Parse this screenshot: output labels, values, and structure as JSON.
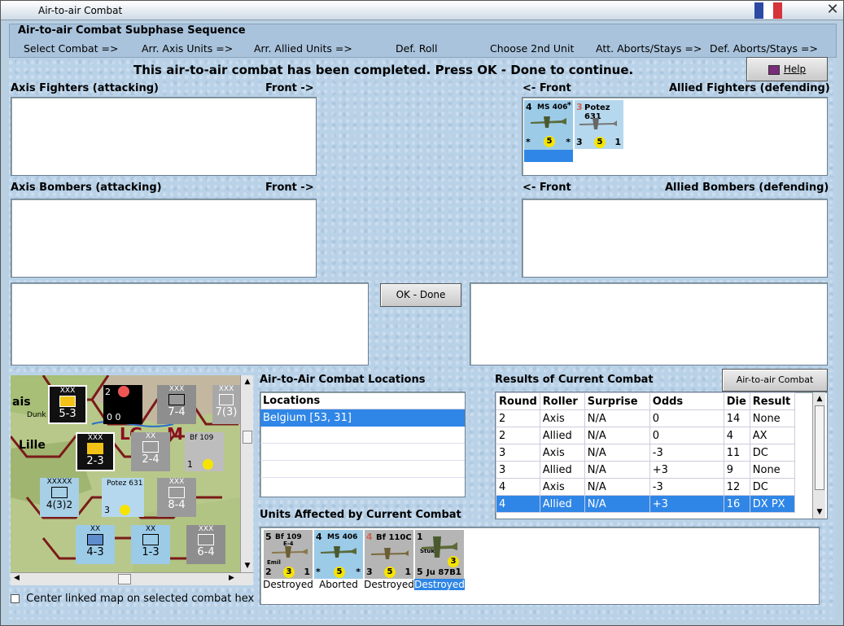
{
  "window": {
    "title": "Air-to-air Combat"
  },
  "sequence": {
    "title": "Air-to-air Combat Subphase Sequence",
    "steps": [
      "Select Combat =>",
      "Arr. Axis Units =>",
      "Arr. Allied Units =>",
      "Def. Roll",
      "Choose 2nd Unit",
      "Att. Aborts/Stays =>",
      "Def. Aborts/Stays =>"
    ]
  },
  "message": "This air-to-air combat has been completed.  Press OK - Done to continue.",
  "help_button": "Help",
  "ok_button": "OK - Done",
  "sections": {
    "axis_fighters": "Axis Fighters (attacking)",
    "axis_fighters_front": "Front ->",
    "allied_fighters_front": "<- Front",
    "allied_fighters": "Allied Fighters (defending)",
    "axis_bombers": "Axis Bombers (attacking)",
    "axis_bombers_front": "Front ->",
    "allied_bombers_front": "<- Front",
    "allied_bombers": "Allied Bombers (defending)"
  },
  "allied_fighters_units": [
    {
      "top_left": "4",
      "name": "MS 406",
      "star": "*",
      "bottom_left": "*",
      "dot": "5",
      "bottom_right": "*"
    },
    {
      "top_left": "3",
      "name": "Potez 631",
      "star": "1",
      "bottom_left": "3",
      "dot": "5",
      "bottom_right": "1"
    }
  ],
  "locations": {
    "title": "Air-to-Air Combat Locations",
    "header": "Locations",
    "rows": [
      "Belgium [53, 31]"
    ]
  },
  "results": {
    "title": "Results of Current Combat",
    "chart_button": "Air-to-air Combat Chart",
    "columns": [
      "Round",
      "Roller",
      "Surprise",
      "Odds",
      "Die",
      "Result"
    ],
    "rows": [
      [
        "2",
        "Axis",
        "N/A",
        "0",
        "14",
        "None"
      ],
      [
        "2",
        "Allied",
        "N/A",
        "0",
        "4",
        "AX"
      ],
      [
        "3",
        "Axis",
        "N/A",
        "-3",
        "11",
        "DC"
      ],
      [
        "3",
        "Allied",
        "N/A",
        "+3",
        "9",
        "None"
      ],
      [
        "4",
        "Axis",
        "N/A",
        "-3",
        "12",
        "DC"
      ],
      [
        "4",
        "Allied",
        "N/A",
        "+3",
        "16",
        "DX PX"
      ]
    ]
  },
  "affected": {
    "title": "Units Affected by Current Combat",
    "units": [
      {
        "top_left": "5",
        "name": "Bf 109",
        "sub": "E-4",
        "extra": "Emil",
        "bottom_left": "2",
        "dot": "3",
        "bottom_right": "1",
        "status": "Destroyed"
      },
      {
        "top_left": "4",
        "name": "MS 406",
        "sub": "",
        "extra": "",
        "bottom_left": "*",
        "dot": "5",
        "bottom_right": "*",
        "status": "Aborted"
      },
      {
        "top_left": "4",
        "name": "Bf 110C",
        "sub": "",
        "extra": "",
        "bottom_left": "3",
        "dot": "5",
        "bottom_right": "1",
        "status": "Destroyed"
      },
      {
        "top_left": "1",
        "name": "Stuka",
        "sub": "",
        "extra": "",
        "bottom_left": "5",
        "dot": "3",
        "bottom_right": "1",
        "label": "Ju 87B",
        "status": "Destroyed"
      }
    ]
  },
  "map": {
    "labels": [
      "ais",
      "Lille",
      "Dunk",
      "G",
      "L",
      "M"
    ],
    "units": [
      {
        "top": "XXX",
        "bottom": "5-3"
      },
      {
        "top": "2",
        "bottom": "0 0"
      },
      {
        "top": "XXX",
        "bottom": "7-4"
      },
      {
        "top": "XXX",
        "bottom": "7(3)"
      },
      {
        "top": "XXX",
        "bottom": "2-3"
      },
      {
        "top": "XX",
        "bottom": "2-4"
      },
      {
        "top": "Bf 109",
        "bottom": "1"
      },
      {
        "top": "XXXXX",
        "bottom": "4(3)2"
      },
      {
        "top": "Potez 631",
        "bottom": "3"
      },
      {
        "top": "XXX",
        "bottom": "8-4"
      },
      {
        "top": "XX",
        "bottom": "4-3"
      },
      {
        "top": "XX",
        "bottom": "1-3"
      },
      {
        "top": "XXX",
        "bottom": "6-4"
      }
    ],
    "checkbox_label": "Center linked map on selected combat hex"
  }
}
